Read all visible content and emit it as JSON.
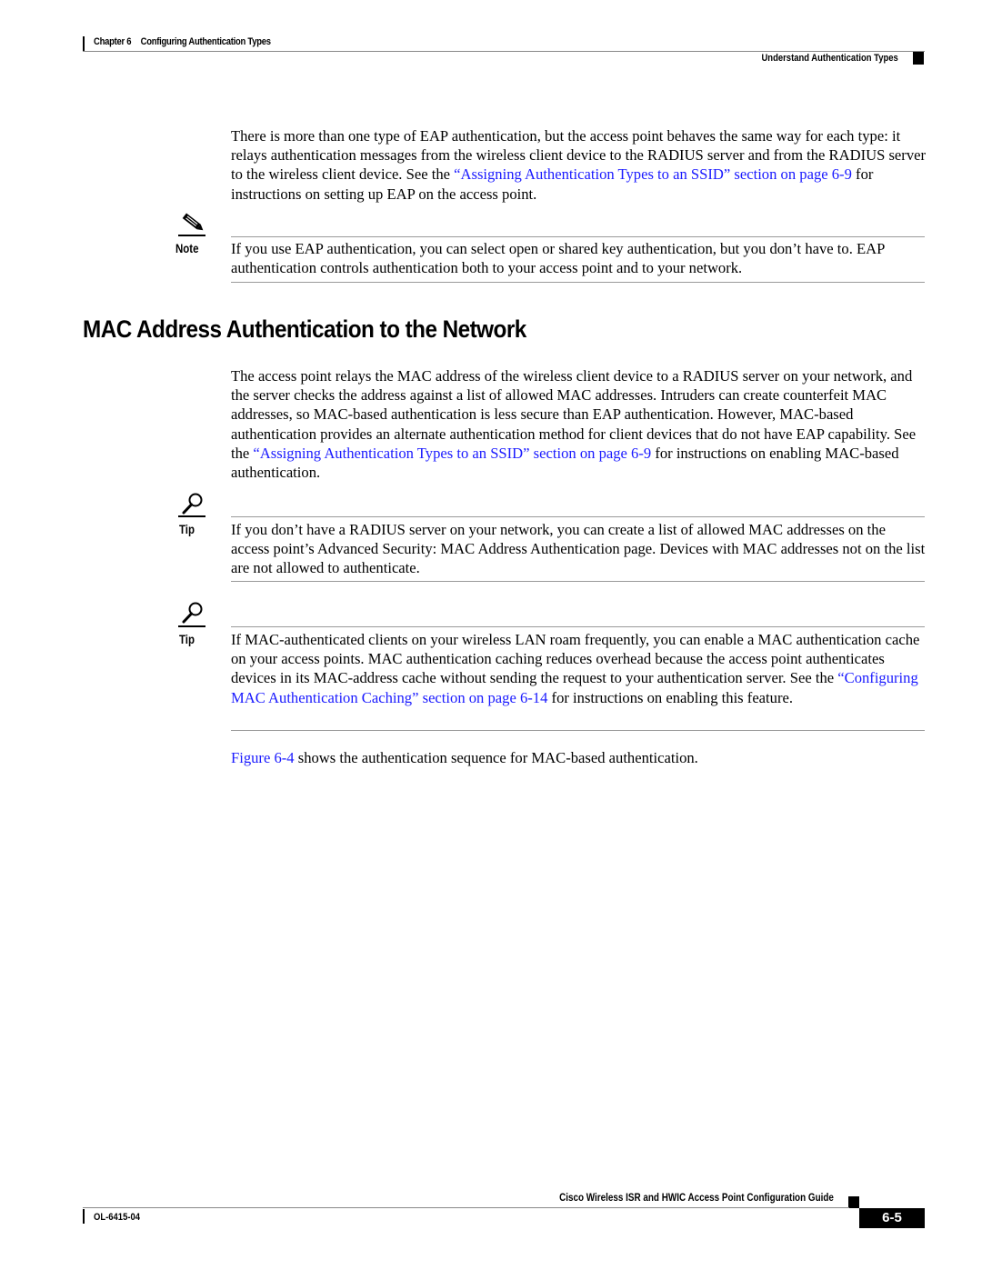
{
  "header": {
    "chapter_label": "Chapter 6",
    "chapter_title": "Configuring Authentication Types",
    "section_title": "Understand Authentication Types"
  },
  "intro": {
    "text_before_link": "There is more than one type of EAP authentication, but the access point behaves the same way for each type: it relays authentication messages from the wireless client device to the RADIUS server and from the RADIUS server to the wireless client device. See the ",
    "link_text": "“Assigning Authentication Types to an SSID” section on page 6-9",
    "text_after_link": " for instructions on setting up EAP on the access point."
  },
  "note": {
    "icon": "pencil-note-icon",
    "label": "Note",
    "text": "If you use EAP authentication, you can select open or shared key authentication, but you don’t have to. EAP authentication controls authentication both to your access point and to your network."
  },
  "section": {
    "heading": "MAC Address Authentication to the Network",
    "para_before_link": "The access point relays the MAC address of the wireless client device to a RADIUS server on your network, and the server checks the address against a list of allowed MAC addresses. Intruders can create counterfeit MAC addresses, so MAC-based authentication is less secure than EAP authentication. However, MAC-based authentication provides an alternate authentication method for client devices that do not have EAP capability. See the ",
    "para_link": "“Assigning Authentication Types to an SSID” section on page 6-9",
    "para_after_link": " for instructions on enabling MAC-based authentication."
  },
  "tips": [
    {
      "icon": "magnifier-tip-icon",
      "label": "Tip",
      "text": "If you don’t have a RADIUS server on your network, you can create a list of allowed MAC addresses on the access point’s Advanced Security: MAC Address Authentication page. Devices with MAC addresses not on the list are not allowed to authenticate."
    },
    {
      "icon": "magnifier-tip-icon",
      "label": "Tip",
      "text_before_link": "If MAC-authenticated clients on your wireless LAN roam frequently, you can enable a MAC authentication cache on your access points. MAC authentication caching reduces overhead because the access point authenticates devices in its MAC-address cache without sending the request to your authentication server. See the ",
      "link_text": "“Configuring MAC Authentication Caching” section on page 6-14",
      "text_after_link": " for instructions on enabling this feature."
    }
  ],
  "figure_ref": {
    "link_text": "Figure 6-4",
    "text": " shows the authentication sequence for MAC-based authentication."
  },
  "footer": {
    "guide_title": "Cisco Wireless ISR and HWIC Access Point Configuration Guide",
    "doc_number": "OL-6415-04",
    "page_number": "6-5"
  },
  "colors": {
    "link": "#1a1aff",
    "text": "#000000",
    "rule": "#999999"
  }
}
